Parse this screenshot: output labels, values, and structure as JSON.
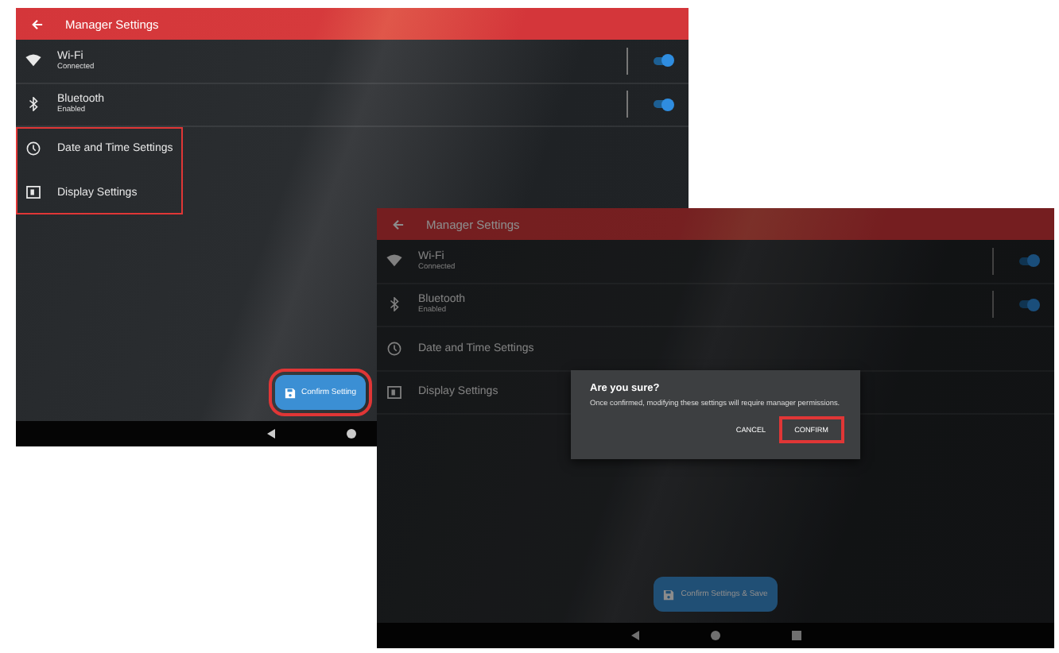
{
  "screens": [
    {
      "title": "Manager Settings",
      "dimmed": false,
      "settings": [
        {
          "kind": "wifi",
          "label": "Wi-Fi",
          "status": "Connected",
          "on": true,
          "highlighted": false
        },
        {
          "kind": "bluetooth",
          "label": "Bluetooth",
          "status": "Enabled",
          "on": true,
          "highlighted": false
        },
        {
          "kind": "clock",
          "label": "Date and Time Settings",
          "highlighted": true
        },
        {
          "kind": "display",
          "label": "Display Settings",
          "highlighted": true
        }
      ],
      "save_button": {
        "label": "Confirm Setting",
        "highlighted": true
      }
    },
    {
      "title": "Manager Settings",
      "dimmed": true,
      "settings": [
        {
          "kind": "wifi",
          "label": "Wi-Fi",
          "status": "Connected",
          "on": true,
          "highlighted": false
        },
        {
          "kind": "bluetooth",
          "label": "Bluetooth",
          "status": "Enabled",
          "on": true,
          "highlighted": false
        },
        {
          "kind": "clock",
          "label": "Date and Time Settings",
          "highlighted": false
        },
        {
          "kind": "display",
          "label": "Display Settings",
          "highlighted": false
        }
      ],
      "save_button": {
        "label": "Confirm Settings & Save",
        "highlighted": false
      },
      "dialog": {
        "title": "Are you sure?",
        "message": "Once confirmed, modifying these settings will require manager permissions.",
        "actions": [
          {
            "label": "CANCEL",
            "highlighted": false
          },
          {
            "label": "CONFIRM",
            "highlighted": true
          }
        ]
      }
    }
  ]
}
